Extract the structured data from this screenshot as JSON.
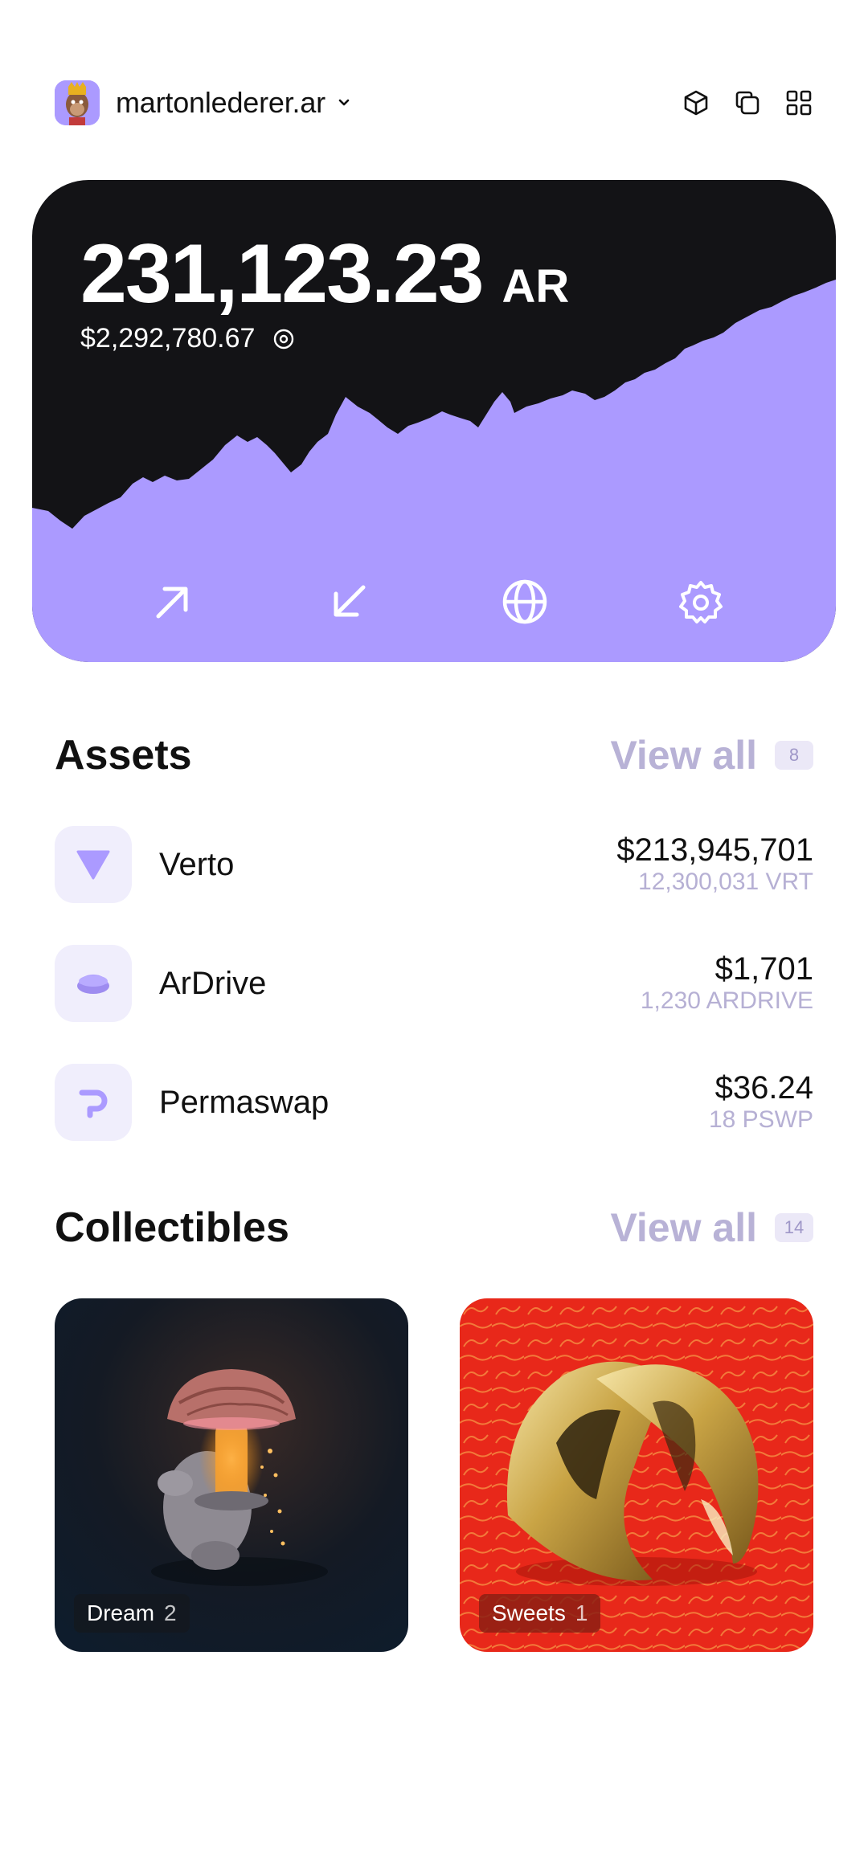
{
  "header": {
    "account_name": "martonlederer.ar",
    "icons": [
      "cube-icon",
      "copy-icon",
      "grid-icon"
    ]
  },
  "balance": {
    "amount": "231,123.23",
    "unit": "AR",
    "fiat": "$2,292,780.67",
    "colors": {
      "card_bg": "#131316",
      "chart_fill": "#ab9aff"
    },
    "actions": [
      "send-arrow-icon",
      "receive-arrow-icon",
      "globe-icon",
      "settings-gear-icon"
    ]
  },
  "assets": {
    "title": "Assets",
    "view_all": "View all",
    "count": "8",
    "items": [
      {
        "name": "Verto",
        "fiat": "$213,945,701",
        "qty": "12,300,031 VRT",
        "icon": "verto-triangle-icon"
      },
      {
        "name": "ArDrive",
        "fiat": "$1,701",
        "qty": "1,230 ARDRIVE",
        "icon": "ardrive-icon"
      },
      {
        "name": "Permaswap",
        "fiat": "$36.24",
        "qty": "18 PSWP",
        "icon": "permaswap-icon"
      }
    ]
  },
  "collectibles": {
    "title": "Collectibles",
    "view_all": "View all",
    "count": "14",
    "items": [
      {
        "name": "Dream",
        "count": "2",
        "image": "mushroom-artwork"
      },
      {
        "name": "Sweets",
        "count": "1",
        "image": "fortune-cookie-artwork"
      }
    ]
  }
}
